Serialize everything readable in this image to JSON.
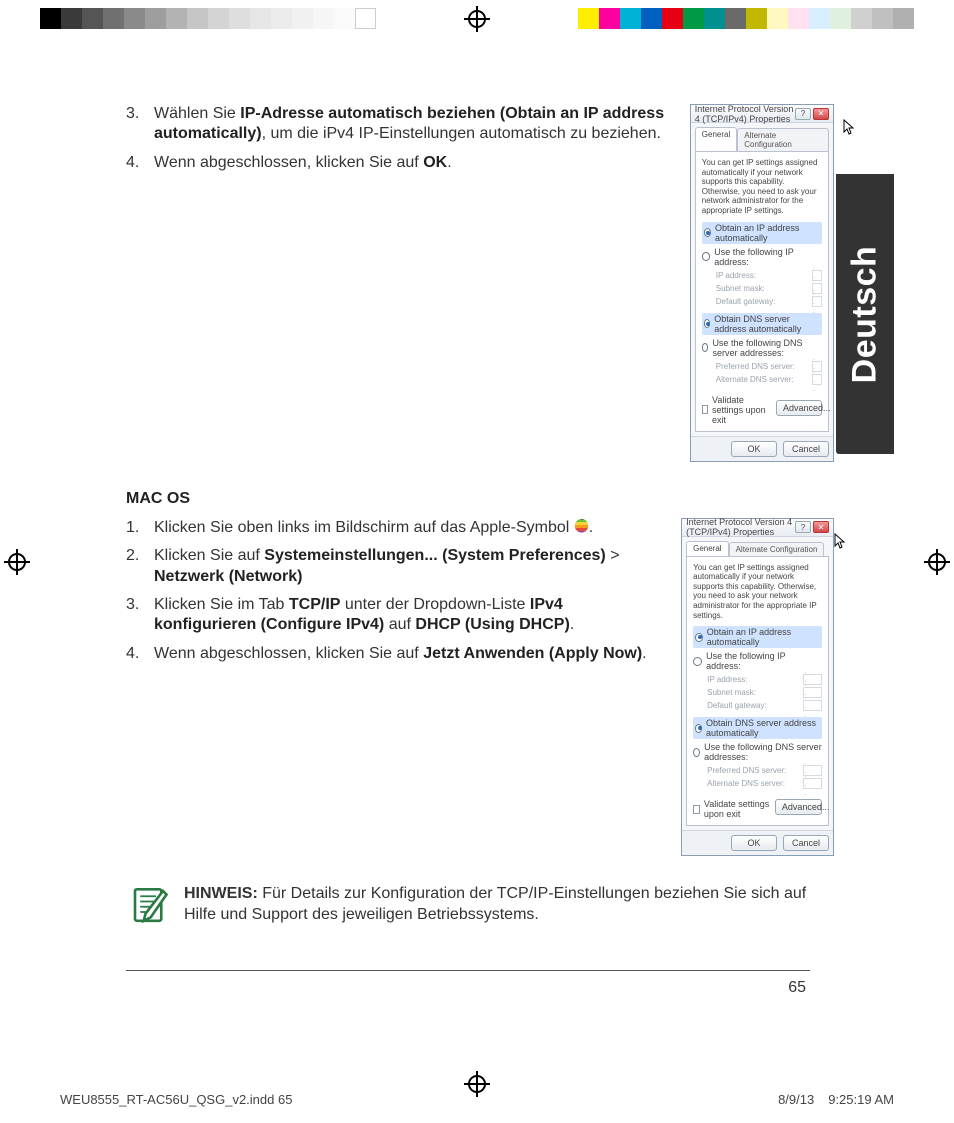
{
  "language_tab": "Deutsch",
  "page_number": "65",
  "slug": {
    "file": "WEU8555_RT-AC56U_QSG_v2.indd   65",
    "date": "8/9/13",
    "time": "9:25:19 AM"
  },
  "section1": {
    "items": [
      {
        "num": "3.",
        "pre": "Wählen Sie ",
        "bold": "IP-Adresse automatisch beziehen (Obtain an IP address automatically)",
        "post": ", um die iPv4 IP-Einstellungen automatisch zu beziehen."
      },
      {
        "num": "4.",
        "pre": "Wenn abgeschlossen, klicken Sie auf ",
        "bold": "OK",
        "post": "."
      }
    ]
  },
  "macos_heading": "MAC OS",
  "section2": {
    "items": [
      {
        "num": "1.",
        "pre": "Klicken Sie oben links im Bildschirm auf das Apple-Symbol ",
        "bold": "",
        "post": "."
      },
      {
        "num": "2.",
        "pre": "Klicken Sie auf ",
        "bold": "Systemeinstellungen... (System Preferences)",
        "mid": " > ",
        "bold2": "Netzwerk (Network)",
        "post": ""
      },
      {
        "num": "3.",
        "pre": "Klicken Sie im Tab ",
        "bold": "TCP/IP",
        "mid": " unter der Dropdown-Liste ",
        "bold2": "IPv4 konfigurieren (Configure IPv4)",
        "mid2": " auf ",
        "bold3": "DHCP (Using DHCP)",
        "post": "."
      },
      {
        "num": "4.",
        "pre": "Wenn abgeschlossen, klicken Sie auf ",
        "bold": "Jetzt Anwenden (Apply Now)",
        "post": "."
      }
    ]
  },
  "note": {
    "lead": "HINWEIS:",
    "body": "  Für Details zur Konfiguration der TCP/IP-Einstellungen beziehen Sie sich auf Hilfe und Support des jeweiligen Betriebssystems."
  },
  "dialog": {
    "title": "Internet Protocol Version 4 (TCP/IPv4) Properties",
    "tab_general": "General",
    "tab_alt": "Alternate Configuration",
    "intro": "You can get IP settings assigned automatically if your network supports this capability. Otherwise, you need to ask your network administrator for the appropriate IP settings.",
    "r_obtain_ip": "Obtain an IP address automatically",
    "r_use_ip": "Use the following IP address:",
    "f_ip": "IP address:",
    "f_mask": "Subnet mask:",
    "f_gw": "Default gateway:",
    "r_obtain_dns": "Obtain DNS server address automatically",
    "r_use_dns": "Use the following DNS server addresses:",
    "f_pdns": "Preferred DNS server:",
    "f_adns": "Alternate DNS server:",
    "chk_validate": "Validate settings upon exit",
    "btn_adv": "Advanced...",
    "btn_ok": "OK",
    "btn_cancel": "Cancel"
  }
}
